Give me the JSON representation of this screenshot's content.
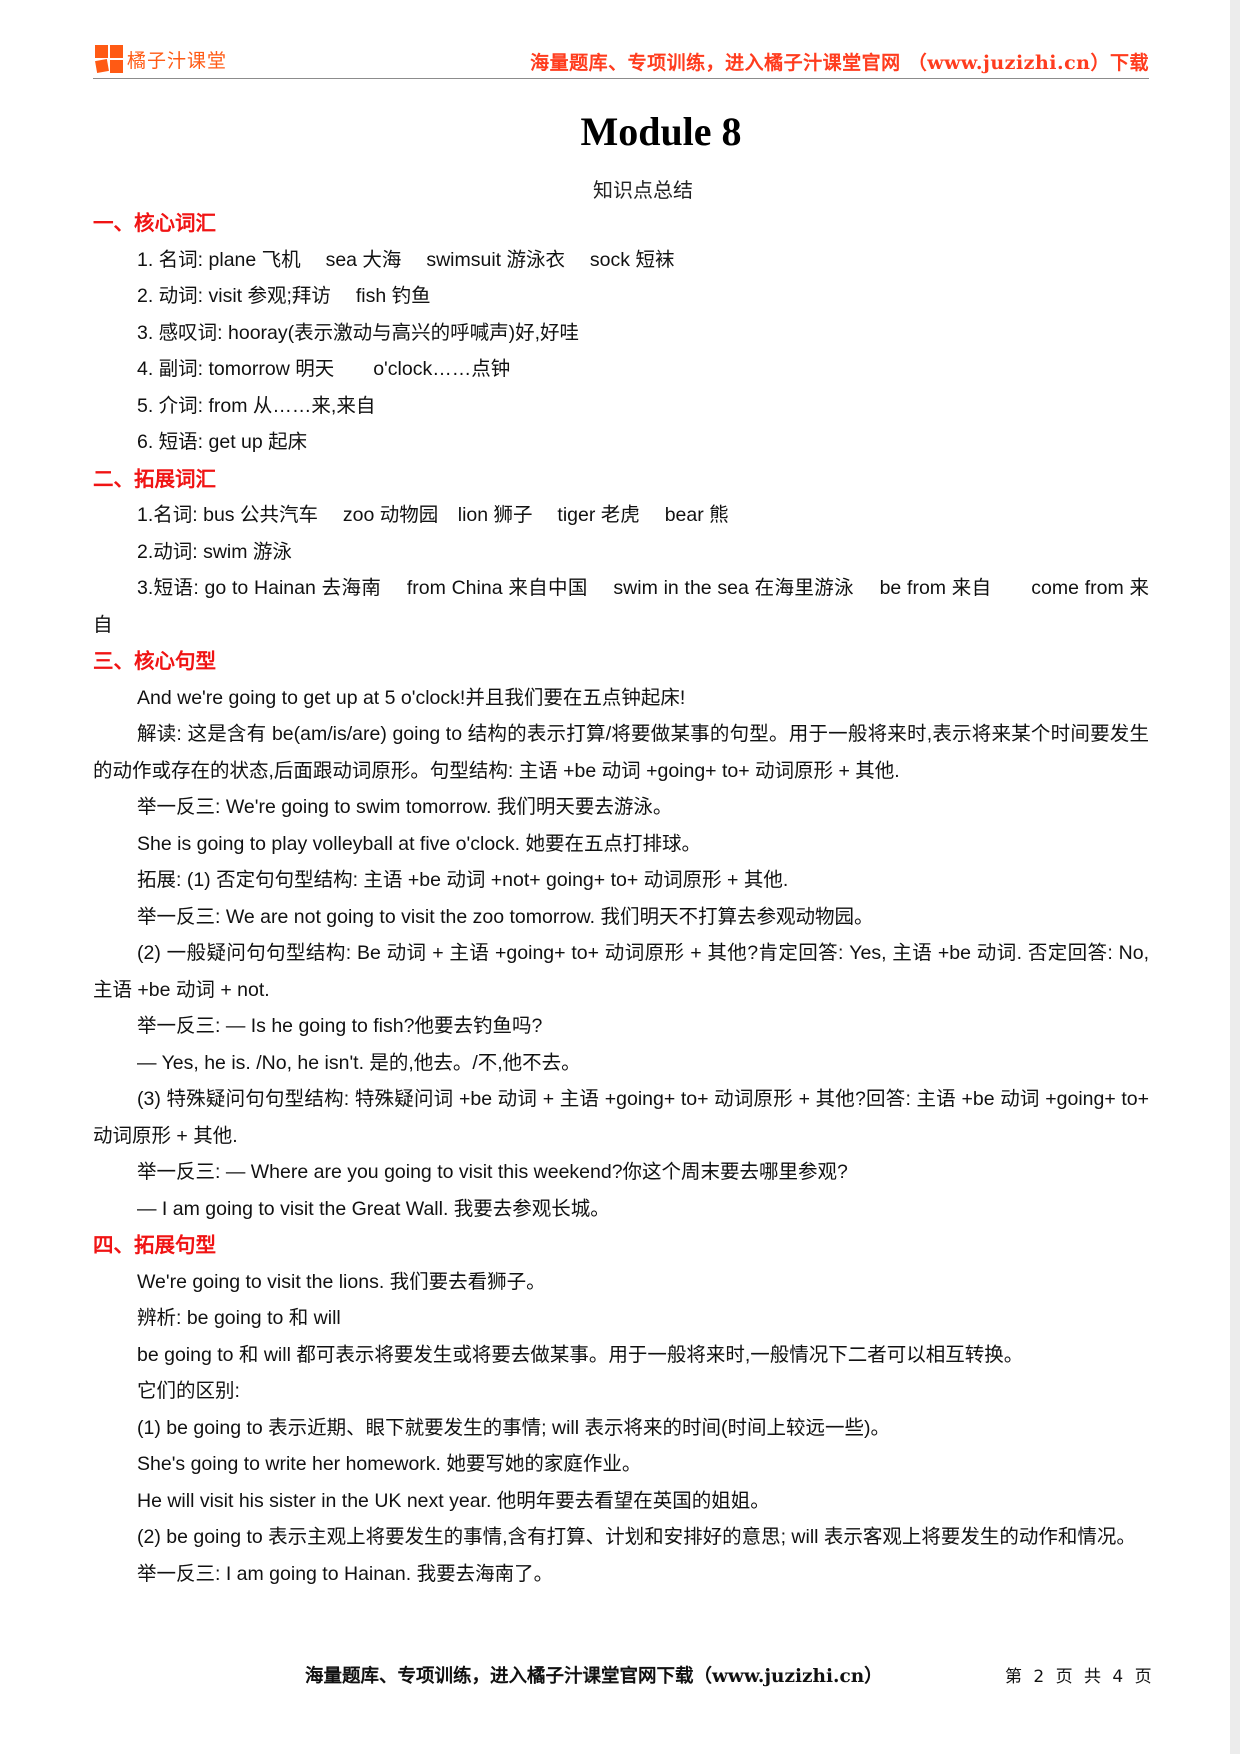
{
  "header": {
    "logo_text": "橘子汁课堂",
    "slogan": "海量题库、专项训练，进入橘子汁课堂官网 （www.juzizhi.cn）下载"
  },
  "title": "Module 8",
  "subtitle": "知识点总结",
  "sections": [
    {
      "heading": "一、核心词汇",
      "lines": [
        "1. 名词: plane 飞机　 sea 大海　 swimsuit 游泳衣　 sock 短袜",
        "2. 动词: visit 参观;拜访　 fish 钓鱼",
        "3. 感叹词: hooray(表示激动与高兴的呼喊声)好,好哇",
        "4. 副词: tomorrow 明天　　o'clock……点钟",
        "5. 介词: from 从……来,来自",
        "6. 短语: get up 起床"
      ]
    },
    {
      "heading": "二、拓展词汇",
      "lines": [
        "1.名词: bus 公共汽车　 zoo 动物园　lion 狮子　 tiger 老虎　 bear 熊",
        "2.动词: swim 游泳",
        "3.短语: go to Hainan 去海南　 from China 来自中国　 swim in the sea 在海里游泳　 be from 来自　　come from 来自"
      ]
    },
    {
      "heading": "三、核心句型",
      "lines": [
        "And we're going to get up at 5 o'clock!并且我们要在五点钟起床!",
        "解读: 这是含有 be(am/is/are) going to 结构的表示打算/将要做某事的句型。用于一般将来时,表示将来某个时间要发生的动作或存在的状态,后面跟动词原形。句型结构: 主语 +be 动词 +going+ to+ 动词原形 + 其他.",
        "举一反三: We're going to swim tomorrow. 我们明天要去游泳。",
        "She is going to play volleyball at five o'clock. 她要在五点打排球。",
        "拓展: (1) 否定句句型结构: 主语 +be 动词 +not+ going+ to+ 动词原形 + 其他.",
        "举一反三: We are not going to visit the zoo tomorrow. 我们明天不打算去参观动物园。",
        "(2) 一般疑问句句型结构: Be 动词 + 主语 +going+ to+ 动词原形 + 其他?肯定回答: Yes, 主语 +be 动词. 否定回答: No, 主语 +be 动词 + not.",
        "举一反三: — Is he going to fish?他要去钓鱼吗?",
        "— Yes, he is. /No, he isn't. 是的,他去。/不,他不去。",
        "(3) 特殊疑问句句型结构: 特殊疑问词 +be 动词 + 主语 +going+ to+ 动词原形 + 其他?回答: 主语 +be 动词 +going+ to+ 动词原形 + 其他.",
        "举一反三: — Where are you going to visit this weekend?你这个周末要去哪里参观?",
        "— I am going to visit the Great Wall. 我要去参观长城。"
      ]
    },
    {
      "heading": "四、拓展句型",
      "lines": [
        "We're going to visit the lions. 我们要去看狮子。",
        "辨析: be going to 和 will",
        "be going to 和 will 都可表示将要发生或将要去做某事。用于一般将来时,一般情况下二者可以相互转换。",
        "它们的区别:",
        "(1) be going to 表示近期、眼下就要发生的事情; will 表示将来的时间(时间上较远一些)。",
        "She's going to write her homework. 她要写她的家庭作业。",
        "He will visit his sister in the UK next year. 他明年要去看望在英国的姐姐。",
        "(2) be going to 表示主观上将要发生的事情,含有打算、计划和安排好的意思; will 表示客观上将要发生的动作和情况。",
        "举一反三: I am going to Hainan. 我要去海南了。"
      ]
    }
  ],
  "footer": {
    "slogan": "海量题库、专项训练，进入橘子汁课堂官网下载（www.juzizhi.cn）",
    "page_label": "第 2 页 共 4 页",
    "current_page": 2,
    "total_pages": 4
  }
}
